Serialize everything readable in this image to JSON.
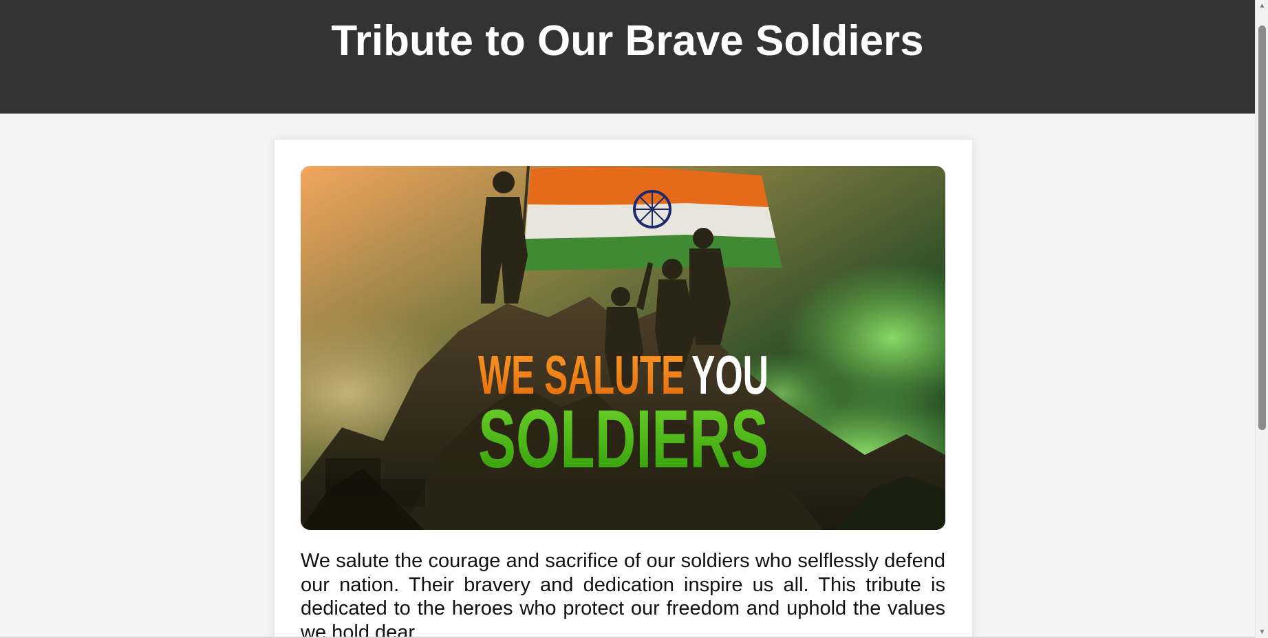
{
  "header": {
    "title": "Tribute to Our Brave Soldiers"
  },
  "hero": {
    "line1_part1": "WE SALUTE",
    "line1_part2": "YOU",
    "line2": "SOLDIERS",
    "colors": {
      "saffron": "#f07a12",
      "white": "#ffffff",
      "green": "#3fb10f",
      "navy_chakra": "#1a2a6c"
    }
  },
  "tribute": {
    "text": "We salute the courage and sacrifice of our soldiers who selflessly defend our nation. Their bravery and dedication inspire us all. This tribute is dedicated to the heroes who protect our freedom and uphold the values we hold dear."
  },
  "scrollbar": {
    "up_icon": "chevron-up-icon",
    "down_icon": "chevron-down-icon"
  }
}
